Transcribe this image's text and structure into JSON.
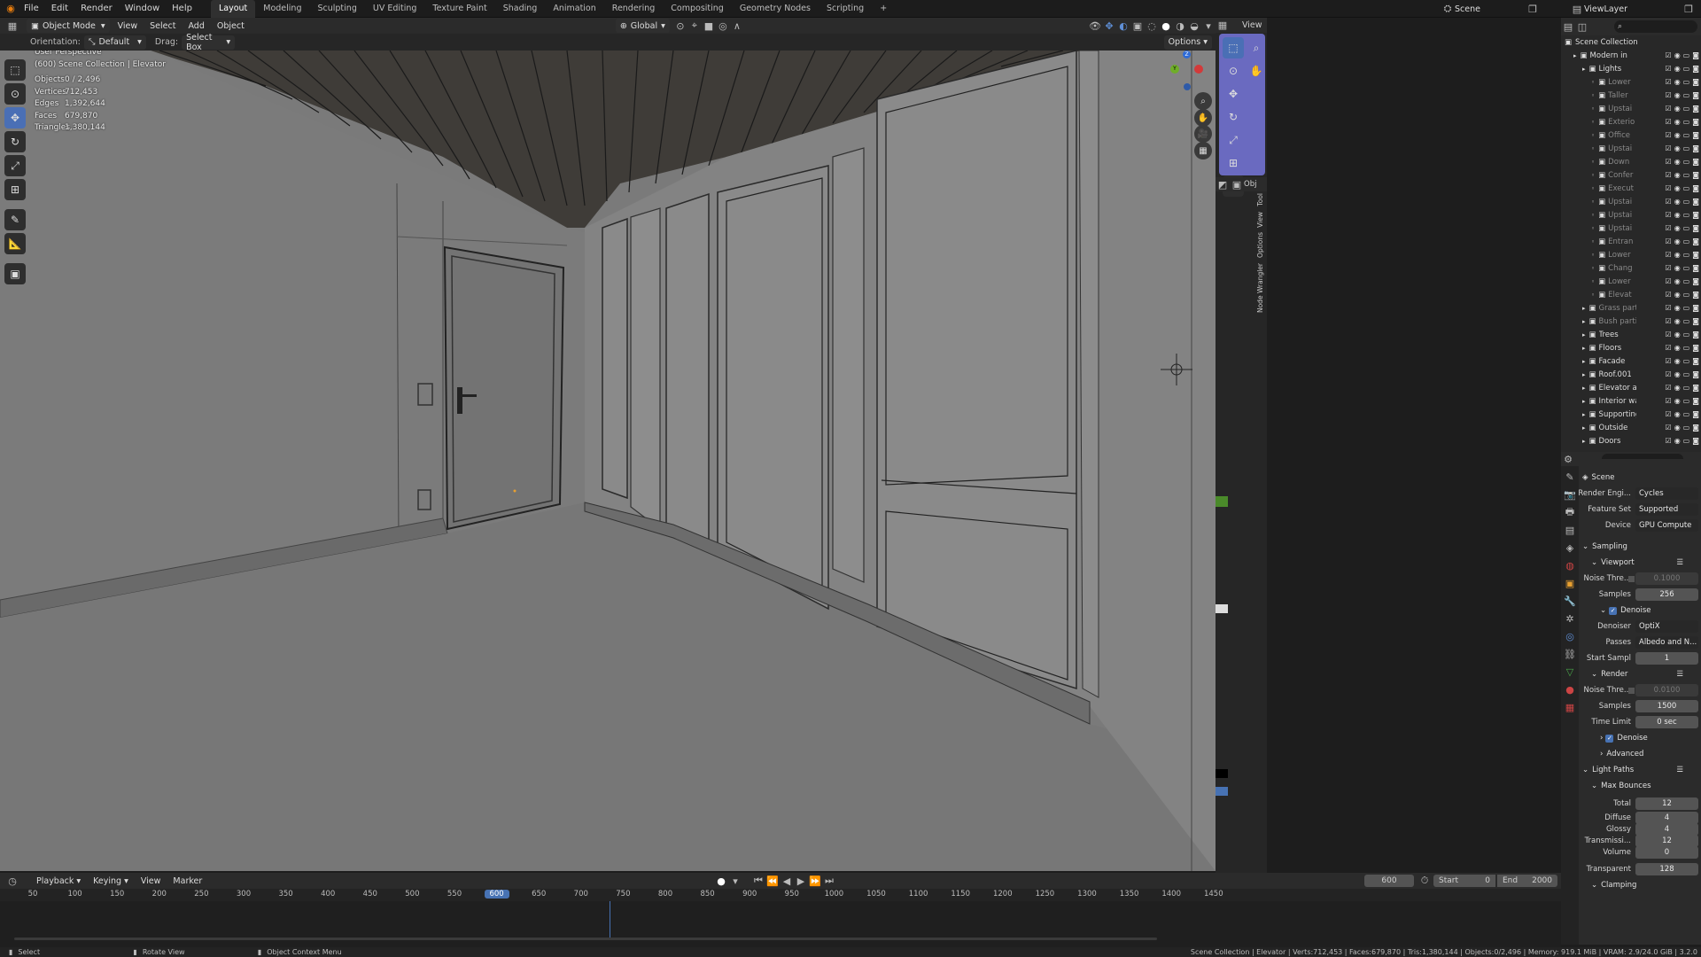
{
  "topbar": {
    "menus": [
      "File",
      "Edit",
      "Render",
      "Window",
      "Help"
    ],
    "workspaces": [
      "Layout",
      "Modeling",
      "Sculpting",
      "UV Editing",
      "Texture Paint",
      "Shading",
      "Animation",
      "Rendering",
      "Compositing",
      "Geometry Nodes",
      "Scripting"
    ],
    "active_workspace": "Layout",
    "scene_name": "Scene",
    "view_layer": "ViewLayer"
  },
  "viewport_header": {
    "mode": "Object Mode",
    "menus": [
      "View",
      "Select",
      "Add",
      "Object"
    ],
    "transform": "Global",
    "view_btn": "View"
  },
  "tool_header": {
    "orientation_label": "Orientation:",
    "orientation_value": "Default",
    "drag_label": "Drag:",
    "drag_value": "Select Box",
    "options": "Options"
  },
  "viewport_info": {
    "title": "User Perspective",
    "context": "(600) Scene Collection | Elevator",
    "stats": [
      {
        "label": "Objects",
        "value": "0 / 2,496"
      },
      {
        "label": "Vertices",
        "value": "712,453"
      },
      {
        "label": "Edges",
        "value": "1,392,644"
      },
      {
        "label": "Faces",
        "value": "679,870"
      },
      {
        "label": "Triangles",
        "value": "1,380,144"
      }
    ]
  },
  "nav_gizmo": {
    "z": "Z",
    "y": "Y"
  },
  "side_tabs": [
    "Tool",
    "View",
    "Options",
    "Node Wrangler"
  ],
  "side_panel_header": "Obj",
  "outliner": {
    "root": "Scene Collection",
    "items": [
      {
        "label": "Modern industr",
        "indent": 1,
        "dim": false
      },
      {
        "label": "Lights",
        "indent": 2,
        "dim": false
      },
      {
        "label": "Lower",
        "indent": 3,
        "dim": true
      },
      {
        "label": "Taller",
        "indent": 3,
        "dim": true
      },
      {
        "label": "Upstai",
        "indent": 3,
        "dim": true
      },
      {
        "label": "Exterio",
        "indent": 3,
        "dim": true
      },
      {
        "label": "Office",
        "indent": 3,
        "dim": true
      },
      {
        "label": "Upstai",
        "indent": 3,
        "dim": true
      },
      {
        "label": "Down",
        "indent": 3,
        "dim": true
      },
      {
        "label": "Confer",
        "indent": 3,
        "dim": true
      },
      {
        "label": "Execut",
        "indent": 3,
        "dim": true
      },
      {
        "label": "Upstai",
        "indent": 3,
        "dim": true
      },
      {
        "label": "Upstai",
        "indent": 3,
        "dim": true
      },
      {
        "label": "Upstai",
        "indent": 3,
        "dim": true
      },
      {
        "label": "Entran",
        "indent": 3,
        "dim": true
      },
      {
        "label": "Lower",
        "indent": 3,
        "dim": true
      },
      {
        "label": "Chang",
        "indent": 3,
        "dim": true
      },
      {
        "label": "Lower",
        "indent": 3,
        "dim": true
      },
      {
        "label": "Elevat",
        "indent": 3,
        "dim": true
      },
      {
        "label": "Grass parti",
        "indent": 2,
        "dim": true
      },
      {
        "label": "Bush partic",
        "indent": 2,
        "dim": true
      },
      {
        "label": "Trees",
        "indent": 2,
        "dim": false
      },
      {
        "label": "Floors",
        "indent": 2,
        "dim": false
      },
      {
        "label": "Facade",
        "indent": 2,
        "dim": false
      },
      {
        "label": "Roof.001",
        "indent": 2,
        "dim": false
      },
      {
        "label": "Elevator ar",
        "indent": 2,
        "dim": false
      },
      {
        "label": "Interior wa",
        "indent": 2,
        "dim": false
      },
      {
        "label": "Supporting",
        "indent": 2,
        "dim": false
      },
      {
        "label": "Outside",
        "indent": 2,
        "dim": false
      },
      {
        "label": "Doors",
        "indent": 2,
        "dim": false
      }
    ]
  },
  "properties": {
    "context": "Scene",
    "render_engine_label": "Render Engi...",
    "render_engine": "Cycles",
    "feature_set_label": "Feature Set",
    "feature_set": "Supported",
    "device_label": "Device",
    "device": "GPU Compute",
    "sampling": "Sampling",
    "viewport": "Viewport",
    "noise_label": "Noise Thre...",
    "vp_noise": "0.1000",
    "samples_label": "Samples",
    "vp_samples": "256",
    "denoise": "Denoise",
    "denoiser_label": "Denoiser",
    "denoiser": "OptiX",
    "passes_label": "Passes",
    "passes": "Albedo and N...",
    "start_label": "Start Sampl",
    "start_value": "1",
    "render": "Render",
    "r_noise": "0.0100",
    "r_samples": "1500",
    "time_limit_label": "Time Limit",
    "time_limit": "0 sec",
    "denoise2": "Denoise",
    "advanced": "Advanced",
    "light_paths": "Light Paths",
    "max_bounces": "Max Bounces",
    "bounces": [
      {
        "label": "Total",
        "value": "12"
      },
      {
        "label": "Diffuse",
        "value": "4"
      },
      {
        "label": "Glossy",
        "value": "4"
      },
      {
        "label": "Transmissi...",
        "value": "12"
      },
      {
        "label": "Volume",
        "value": "0"
      }
    ],
    "transparent_label": "Transparent",
    "transparent": "128",
    "clamping": "Clamping"
  },
  "timeline": {
    "menus": [
      "Playback",
      "Keying",
      "View",
      "Marker"
    ],
    "current_frame": "600",
    "start_label": "Start",
    "start": "0",
    "end_label": "End",
    "end": "2000",
    "ticks": [
      "50",
      "100",
      "150",
      "200",
      "250",
      "300",
      "350",
      "400",
      "450",
      "500",
      "550",
      "600",
      "650",
      "700",
      "750",
      "800",
      "850",
      "900",
      "950",
      "1000",
      "1050",
      "1100",
      "1150",
      "1200",
      "1250",
      "1300",
      "1350",
      "1400",
      "1450"
    ]
  },
  "statusbar": {
    "select": "Select",
    "rotate": "Rotate View",
    "context_menu": "Object Context Menu",
    "stats": "Scene Collection | Elevator | Verts:712,453 | Faces:679,870 | Tris:1,380,144 | Objects:0/2,496 | Memory: 919.1 MiB | VRAM: 2.9/24.0 GiB | 3.2.0"
  }
}
